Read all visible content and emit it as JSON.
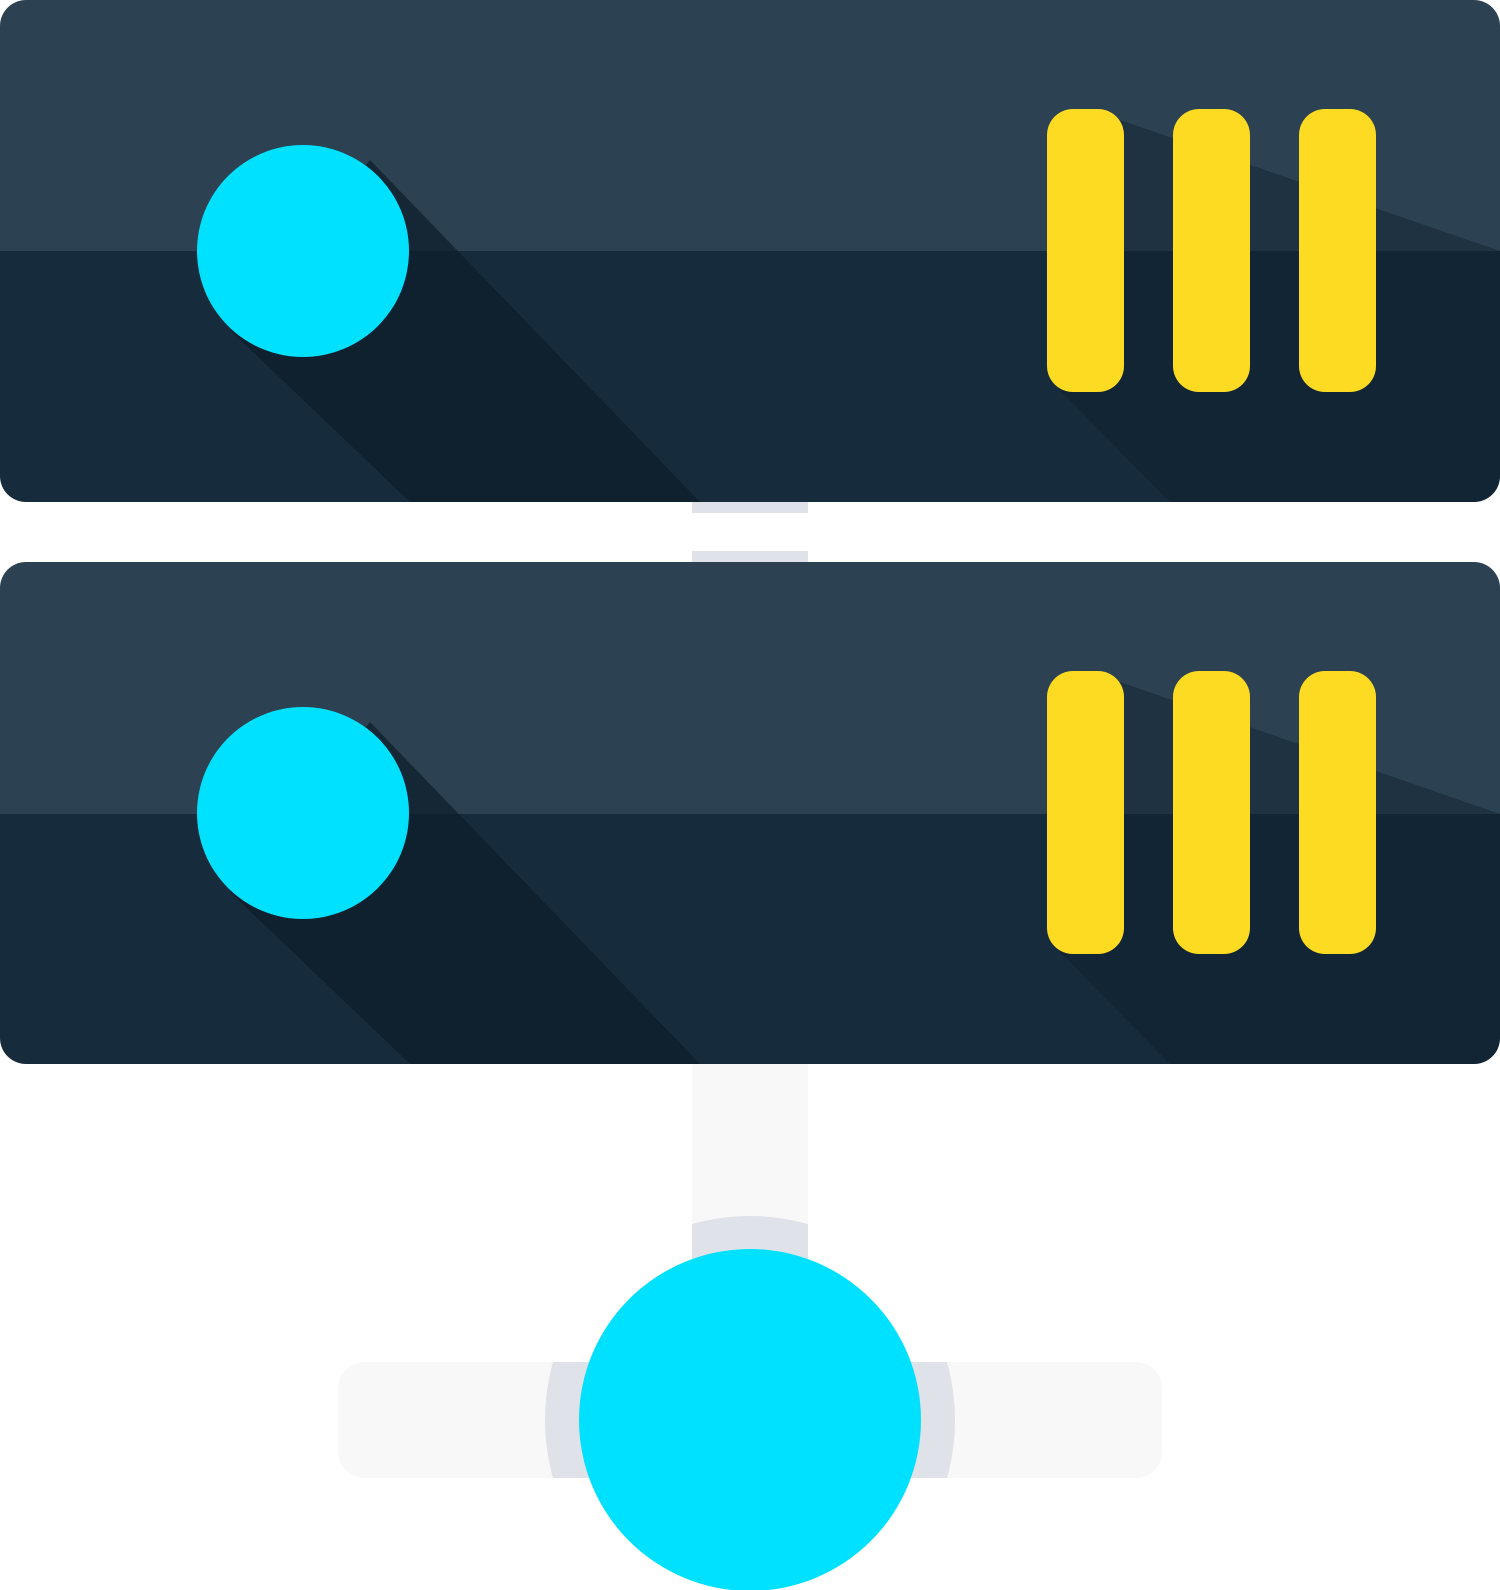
{
  "illustration": {
    "subject": "server-rack-network-icon",
    "units": [
      {
        "led": "cyan-indicator-light",
        "slots": [
          "drive-bay-1",
          "drive-bay-2",
          "drive-bay-3"
        ]
      },
      {
        "led": "cyan-indicator-light",
        "slots": [
          "drive-bay-1",
          "drive-bay-2",
          "drive-bay-3"
        ]
      }
    ],
    "network_node": "cyan-network-hub"
  },
  "colors": {
    "background": "#ffffff",
    "unit_top": "#2c4252",
    "unit_bottom": "#162b3b",
    "long_shadow": "#0d1f2c",
    "led": "#00e1ff",
    "drive_bay": "#fcdb22",
    "cable_light": "#f8f8f9",
    "cable_mid": "#dfe2e9"
  }
}
